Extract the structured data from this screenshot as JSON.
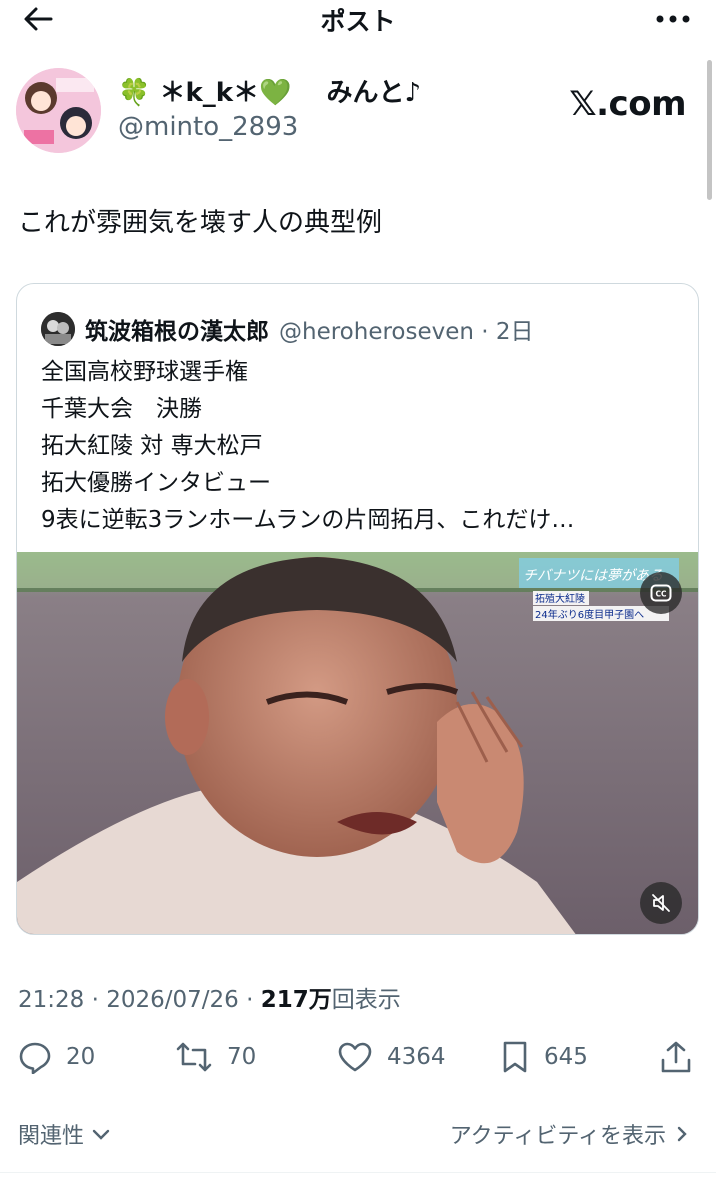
{
  "topbar": {
    "title": "ポスト"
  },
  "author": {
    "name_prefix": "🍀",
    "name_main": "＊k_k＊",
    "name_heart": "💚",
    "name_suffix": "みんと♪",
    "handle": "@minto_2893",
    "watermark": "𝕏.com"
  },
  "post": {
    "text": "これが雰囲気を壊す人の典型例"
  },
  "quote": {
    "name": "筑波箱根の漢太郎",
    "handle": "@heroheroseven · 2日",
    "lines": [
      "全国高校野球選手権",
      "千葉大会　決勝",
      "拓大紅陵 対 専大松戸",
      "拓大優勝インタビュー",
      "9表に逆転3ランホームランの片岡拓月、これだけ…"
    ],
    "media": {
      "overlay_line1": "チバナツには夢がある",
      "overlay_line2": "拓殖大紅陵",
      "overlay_line3": "24年ぶり6度目甲子園へ"
    }
  },
  "meta": {
    "time": "21:28",
    "date": "2026/07/26",
    "views_count": "217万",
    "views_label": "回表示"
  },
  "actions": {
    "replies": "20",
    "reposts": "70",
    "likes": "4364",
    "bookmarks": "645"
  },
  "footer": {
    "related": "関連性",
    "activity": "アクティビティを表示"
  }
}
